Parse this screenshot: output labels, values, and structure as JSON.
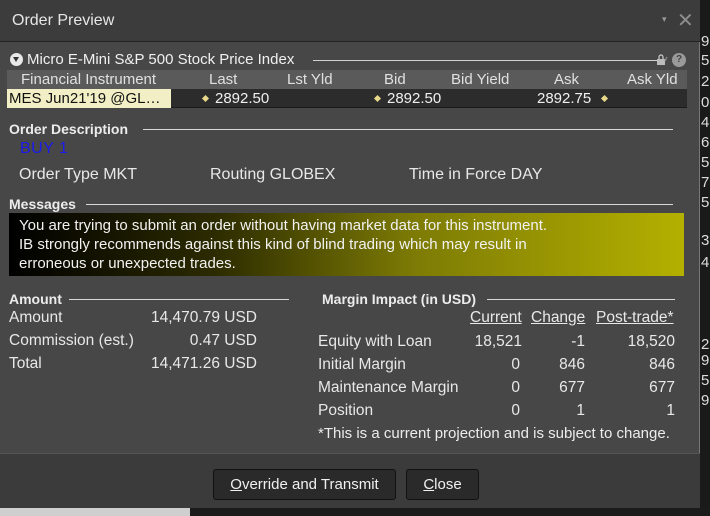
{
  "window": {
    "title": "Order Preview",
    "menu_glyph": "▾",
    "close_glyph": "✕"
  },
  "instrument": {
    "section_title": "Micro E-Mini S&P 500 Stock Price Index",
    "columns": [
      "Financial Instrument",
      "Last",
      "Lst Yld",
      "Bid",
      "Bid Yield",
      "Ask",
      "Ask Yld"
    ],
    "row": {
      "name": "MES  Jun21'19 @GL…",
      "last": "2892.50",
      "last_yield": "",
      "bid": "2892.50",
      "bid_yield": "",
      "ask": "2892.75",
      "ask_yield": ""
    },
    "help_glyph": "?"
  },
  "order_description": {
    "section_title": "Order Description",
    "action": "BUY 1",
    "order_type": "Order Type MKT",
    "routing": "Routing GLOBEX",
    "time_in_force": "Time in Force DAY"
  },
  "messages": {
    "section_title": "Messages",
    "lines": [
      "You are trying to submit an order without having market data for this instrument.",
      "IB strongly recommends against this kind of blind trading which may result in",
      "erroneous or unexpected trades."
    ],
    "colors": {
      "start": "#000000",
      "end": "#b4b000"
    }
  },
  "amount": {
    "section_title": "Amount",
    "rows": [
      {
        "label": "Amount",
        "value": "14,470.79 USD"
      },
      {
        "label": "Commission (est.)",
        "value": "0.47 USD"
      },
      {
        "label": "Total",
        "value": "14,471.26 USD"
      }
    ]
  },
  "margin": {
    "section_title": "Margin Impact (in USD)",
    "headers": {
      "current": "Current",
      "change": "Change",
      "post": "Post-trade*"
    },
    "rows": [
      {
        "label": "Equity with Loan",
        "current": "18,521",
        "change": "-1",
        "post": "18,520"
      },
      {
        "label": "Initial Margin",
        "current": "0",
        "change": "846",
        "post": "846"
      },
      {
        "label": "Maintenance Margin",
        "current": "0",
        "change": "677",
        "post": "677"
      },
      {
        "label": "Position",
        "current": "0",
        "change": "1",
        "post": "1"
      }
    ],
    "footnote": "*This is a current projection and is subject to change."
  },
  "buttons": {
    "override": {
      "underlined": "O",
      "rest": "verride and Transmit"
    },
    "close": {
      "underlined": "C",
      "rest": "lose"
    }
  },
  "background_strip": [
    "9",
    "5",
    "2",
    "0",
    "4",
    "6",
    "5",
    "7",
    "5",
    "3",
    "4",
    "2",
    "9",
    "5",
    "9"
  ],
  "accent_colors": {
    "buy": "#1b1bf0",
    "instrument_highlight": "#f2efc6"
  }
}
